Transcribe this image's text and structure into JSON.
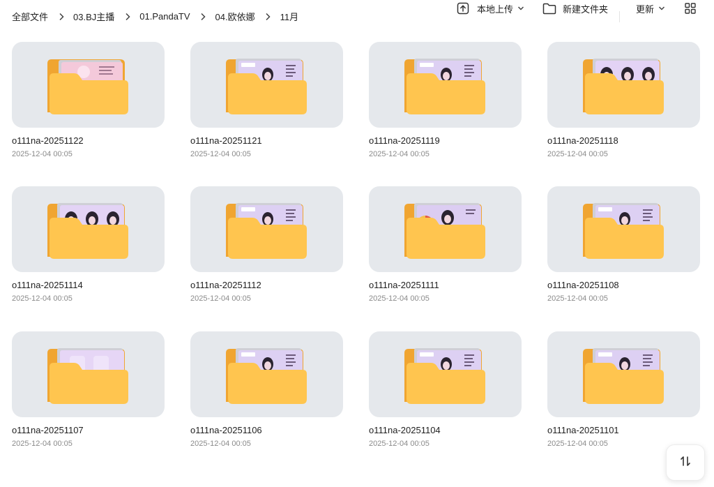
{
  "breadcrumb": [
    "全部文件",
    "03.BJ主播",
    "01.PandaTV",
    "04.欧依娜",
    "11月"
  ],
  "toolbar": {
    "upload_label": "本地上传",
    "new_folder_label": "新建文件夹",
    "sort_label": "更新"
  },
  "colors": {
    "folder_back": "#f0a531",
    "folder_front": "#ffc54f",
    "thumb_bg": "#e5e8ec",
    "preview_pink": "#f3c7e0",
    "preview_lavender": "#d9c6f2"
  },
  "folders": [
    {
      "name": "o111na-20251122",
      "date": "2025-12-04 00:05",
      "preview": "pink"
    },
    {
      "name": "o111na-20251121",
      "date": "2025-12-04 00:05",
      "preview": "stream"
    },
    {
      "name": "o111na-20251119",
      "date": "2025-12-04 00:05",
      "preview": "stream"
    },
    {
      "name": "o111na-20251118",
      "date": "2025-12-04 00:05",
      "preview": "triple"
    },
    {
      "name": "o111na-20251114",
      "date": "2025-12-04 00:05",
      "preview": "triple"
    },
    {
      "name": "o111na-20251112",
      "date": "2025-12-04 00:05",
      "preview": "stream"
    },
    {
      "name": "o111na-20251111",
      "date": "2025-12-04 00:05",
      "preview": "wheel"
    },
    {
      "name": "o111na-20251108",
      "date": "2025-12-04 00:05",
      "preview": "stream"
    },
    {
      "name": "o111na-20251107",
      "date": "2025-12-04 00:05",
      "preview": "blank"
    },
    {
      "name": "o111na-20251106",
      "date": "2025-12-04 00:05",
      "preview": "stream"
    },
    {
      "name": "o111na-20251104",
      "date": "2025-12-04 00:05",
      "preview": "stream"
    },
    {
      "name": "o111na-20251101",
      "date": "2025-12-04 00:05",
      "preview": "stream"
    }
  ],
  "icons": {
    "upload": "upload-icon",
    "new_folder": "folder-outline-icon",
    "sort_chevron": "chevron-down-icon",
    "view_toggle": "grid-view-icon",
    "sort_fab": "sort-arrows-icon",
    "crumb_sep": "chevron-right-icon"
  }
}
